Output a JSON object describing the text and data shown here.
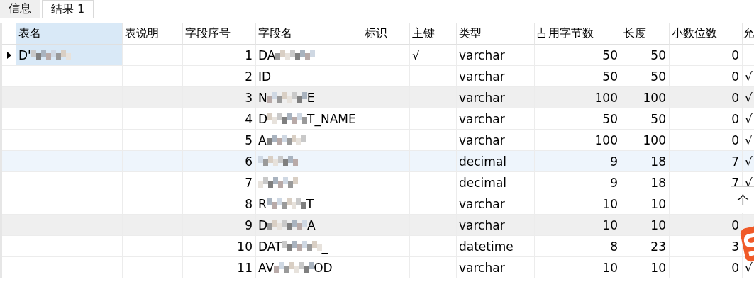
{
  "tabs": [
    {
      "label": "信息",
      "selected": false
    },
    {
      "label": "结果 1",
      "selected": true
    }
  ],
  "columns": [
    {
      "label": "表名",
      "selected": true
    },
    {
      "label": "表说明",
      "selected": false
    },
    {
      "label": "字段序号",
      "selected": false
    },
    {
      "label": "字段名",
      "selected": false
    },
    {
      "label": "标识",
      "selected": false
    },
    {
      "label": "主键",
      "selected": false
    },
    {
      "label": "类型",
      "selected": false
    },
    {
      "label": "占用字节数",
      "selected": false
    },
    {
      "label": "长度",
      "selected": false
    },
    {
      "label": "小数位数",
      "selected": false
    },
    {
      "label": "允",
      "selected": false
    }
  ],
  "rows": [
    {
      "selected": true,
      "striped": false,
      "hover": false,
      "table_name": [
        "D'"
      ],
      "table_blurred": true,
      "index": "1",
      "field": [
        "DA"
      ],
      "field_blurred": true,
      "primary_key": "√",
      "type": "varchar",
      "bytes": "50",
      "length": "50",
      "scale": "0"
    },
    {
      "selected": false,
      "striped": false,
      "hover": false,
      "index": "2",
      "field": [
        "ID"
      ],
      "field_blurred": false,
      "type": "varchar",
      "bytes": "50",
      "length": "50",
      "scale": "0",
      "nullable": "√"
    },
    {
      "selected": false,
      "striped": true,
      "hover": false,
      "index": "3",
      "field": [
        "N",
        "E"
      ],
      "field_blurred": true,
      "type": "varchar",
      "bytes": "100",
      "length": "100",
      "scale": "0",
      "nullable": "√"
    },
    {
      "selected": false,
      "striped": false,
      "hover": false,
      "index": "4",
      "field": [
        "D",
        "T_NAME"
      ],
      "field_blurred": true,
      "type": "varchar",
      "bytes": "50",
      "length": "50",
      "scale": "0",
      "nullable": "√"
    },
    {
      "selected": false,
      "striped": false,
      "hover": false,
      "index": "5",
      "field": [
        "A"
      ],
      "field_blurred": true,
      "type": "varchar",
      "bytes": "100",
      "length": "100",
      "scale": "0",
      "nullable": "√"
    },
    {
      "selected": false,
      "striped": false,
      "hover": true,
      "index": "6",
      "field_blurred": true,
      "type": "decimal",
      "bytes": "9",
      "length": "18",
      "scale": "7",
      "nullable": "√"
    },
    {
      "selected": false,
      "striped": false,
      "hover": false,
      "index": "7",
      "field_blurred": true,
      "type": "decimal",
      "bytes": "9",
      "length": "18",
      "scale": "7",
      "nullable": "√"
    },
    {
      "selected": false,
      "striped": false,
      "hover": false,
      "index": "8",
      "field": [
        "R",
        "T"
      ],
      "field_blurred": true,
      "type": "varchar",
      "bytes": "10",
      "length": "10"
    },
    {
      "selected": false,
      "striped": true,
      "hover": false,
      "index": "9",
      "field": [
        "D",
        "A"
      ],
      "field_blurred": true,
      "type": "varchar",
      "bytes": "10",
      "length": "10",
      "scale": "0"
    },
    {
      "selected": false,
      "striped": false,
      "hover": false,
      "index": "10",
      "field": [
        "DAT",
        "_"
      ],
      "field_blurred": true,
      "type": "datetime",
      "bytes": "8",
      "length": "23",
      "scale": "3"
    },
    {
      "selected": false,
      "striped": false,
      "hover": false,
      "index": "11",
      "field": [
        "AV",
        "OD"
      ],
      "field_blurred": true,
      "type": "varchar",
      "bytes": "10",
      "length": "10",
      "scale": "0",
      "nullable": "√"
    }
  ],
  "tooltip": {
    "text": "个"
  }
}
